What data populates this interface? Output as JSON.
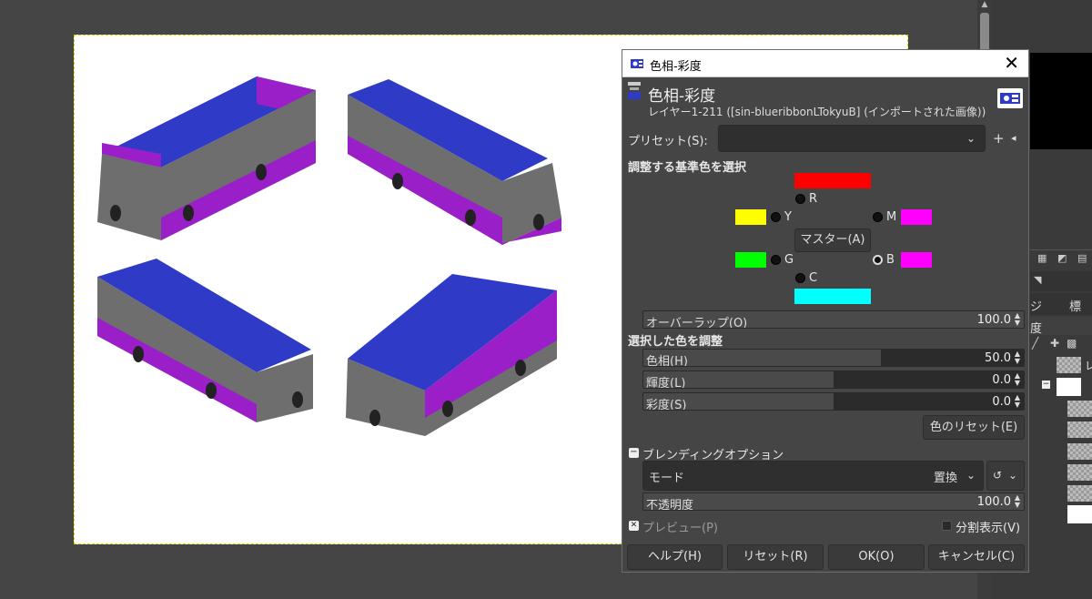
{
  "dialog": {
    "window_title": "色相-彩度",
    "header_title": "色相-彩度",
    "header_subtitle": "レイヤー1-211 ([sin-blueribbonLTokyuB] (インポートされた画像))",
    "preset_label": "プリセット(S):",
    "preset_value": "",
    "select_base_color_heading": "調整する基準色を選択",
    "colors": {
      "R": {
        "label": "R",
        "swatch": "#ff0000"
      },
      "Y": {
        "label": "Y",
        "swatch": "#ffff00"
      },
      "G": {
        "label": "G",
        "swatch": "#00ff00"
      },
      "C": {
        "label": "C",
        "swatch": "#00ffff"
      },
      "B": {
        "label": "B",
        "swatch": "#ff00ff"
      },
      "M": {
        "label": "M",
        "swatch": "#ff00ff"
      }
    },
    "selected_color": "B",
    "master_button": "マスター(A)",
    "overlap": {
      "label": "オーバーラップ(O)",
      "value": "100.0",
      "fraction": 1.0
    },
    "adjust_heading": "選択した色を調整",
    "hue": {
      "label": "色相(H)",
      "value": "50.0",
      "fraction": 0.625
    },
    "lightness": {
      "label": "輝度(L)",
      "value": "0.0",
      "fraction": 0.5
    },
    "saturation": {
      "label": "彩度(S)",
      "value": "0.0",
      "fraction": 0.5
    },
    "reset_color_button": "色のリセット(E)",
    "blending_label": "ブレンディングオプション",
    "mode_label": "モード",
    "mode_value": "置換",
    "opacity": {
      "label": "不透明度",
      "value": "100.0",
      "fraction": 1.0
    },
    "preview_label": "プレビュー(P)",
    "preview_checked": true,
    "split_view_label": "分割表示(V)",
    "split_view_checked": false,
    "buttons": {
      "help": "ヘルプ(H)",
      "reset": "リセット(R)",
      "ok": "OK(O)",
      "cancel": "キャンセル(C)"
    }
  },
  "right_panel": {
    "mode_text": "標準",
    "opacity_text": "度",
    "layer_label": "レ"
  },
  "colors": {
    "accent_blue": "#2f3bc7",
    "bus_purple": "#9b1fc8",
    "bus_grey": "#6e6e6e"
  }
}
